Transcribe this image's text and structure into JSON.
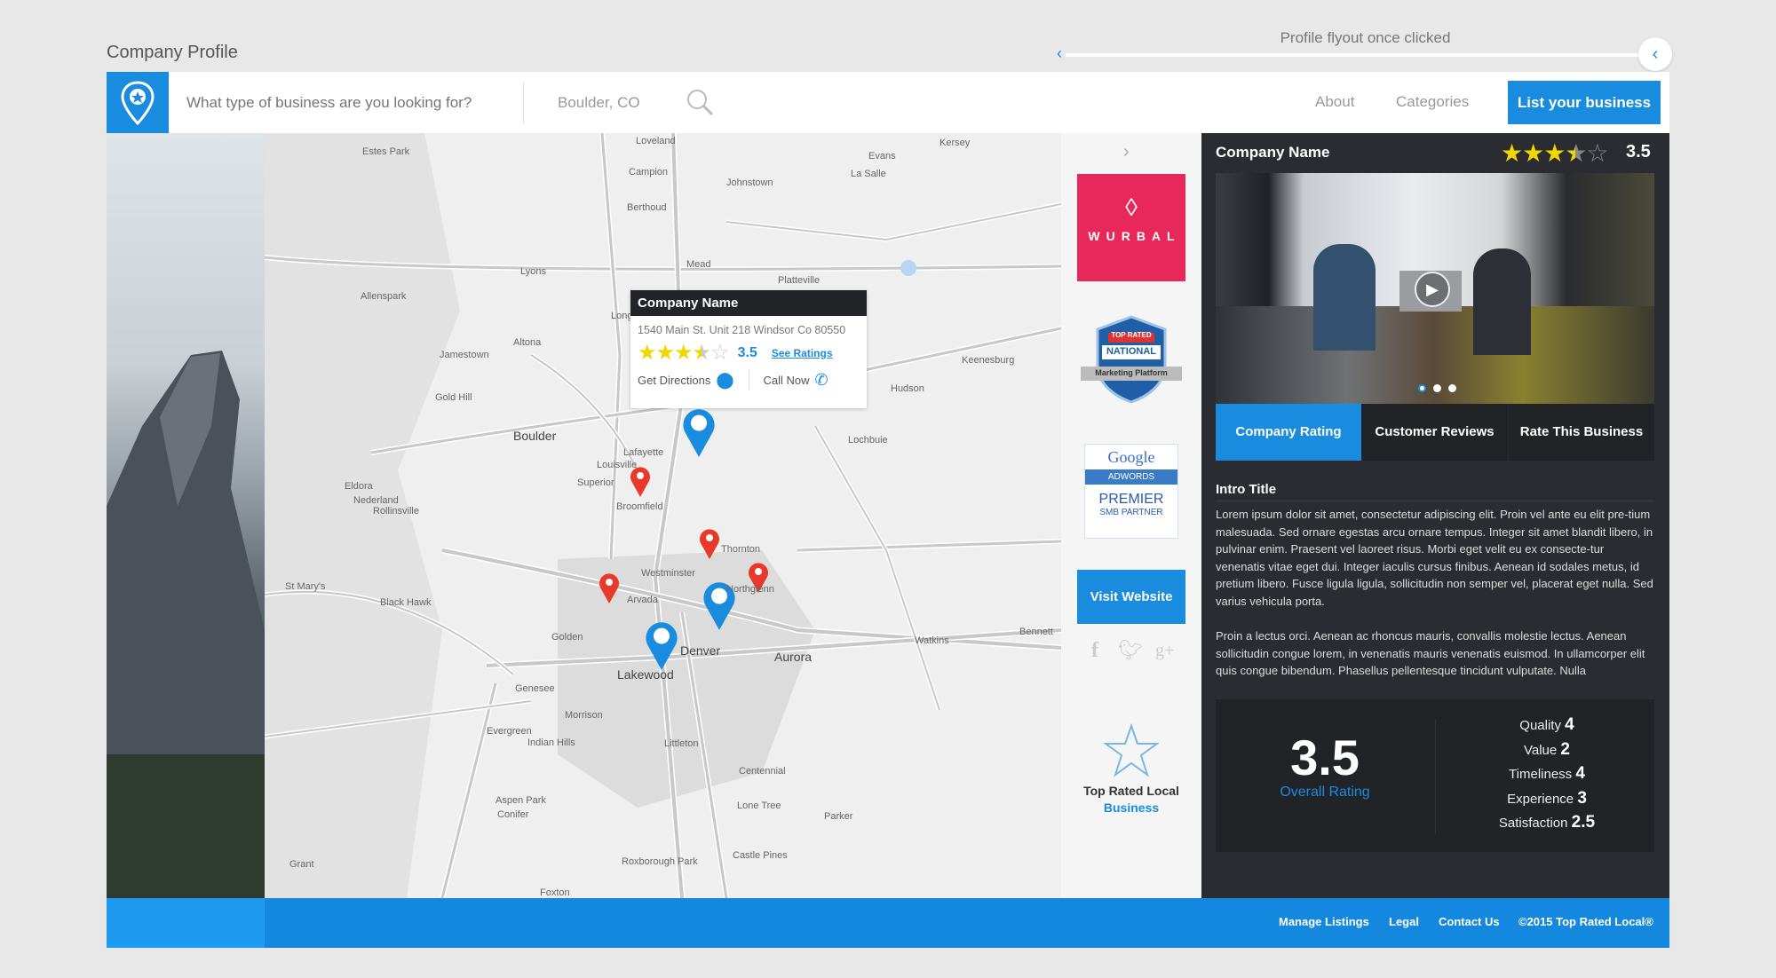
{
  "page": {
    "title": "Company Profile",
    "annotation": "Profile flyout once clicked"
  },
  "header": {
    "search_placeholder": "What type of business are you looking for?",
    "location_value": "Boulder, CO",
    "nav": [
      "About",
      "Categories"
    ],
    "cta": "List your business"
  },
  "map": {
    "cities": [
      "Loveland",
      "Estes Park",
      "Campion",
      "Berthoud",
      "Johnstown",
      "Evans",
      "La Salle",
      "Kersey",
      "Mead",
      "Platteville",
      "Lyons",
      "Allenspark",
      "Longmont",
      "Jamestown",
      "Altona",
      "Gold Hill",
      "Boulder",
      "Lafayette",
      "Louisville",
      "Superior",
      "Broomfield",
      "Eldora",
      "Nederland",
      "Rollinsville",
      "Thornton",
      "Westminster",
      "Arvada",
      "Northglenn",
      "Denver",
      "Aurora",
      "Lakewood",
      "Golden",
      "Black Hawk",
      "St Mary's",
      "Genesee",
      "Morrison",
      "Evergreen",
      "Indian Hills",
      "Littleton",
      "Centennial",
      "Aspen Park",
      "Conifer",
      "Lone Tree",
      "Parker",
      "Castle Pines",
      "Roxborough Park",
      "Grant",
      "Foxton",
      "Keenesburg",
      "Hudson",
      "Lochbuie",
      "Watkins",
      "Bennett"
    ],
    "popup": {
      "name": "Company Name",
      "address": "1540 Main St. Unit 218 Windsor Co 80550",
      "rating": "3.5",
      "see_ratings": "See Ratings",
      "directions": "Get Directions",
      "call": "Call Now"
    }
  },
  "side": {
    "sponsor1": "WURBAL",
    "badge_top": "TOP RATED",
    "badge_mid": "NATIONAL",
    "badge_bottom": "Marketing Platform",
    "google": "Google",
    "adwords": "ADWORDS",
    "premier": "PREMIER",
    "smb": "SMB PARTNER",
    "visit": "Visit Website",
    "trl_line1": "Top Rated Local",
    "trl_line2": "Business"
  },
  "panel": {
    "company_name": "Company Name",
    "rating": "3.5",
    "rating_value": 3.5,
    "tabs": [
      "Company Rating",
      "Customer Reviews",
      "Rate This Business"
    ],
    "active_tab": "Company Rating",
    "intro_title": "Intro Title",
    "para1": "Lorem ipsum dolor sit amet, consectetur adipiscing elit. Proin vel ante eu elit pre-tium malesuada. Sed ornare egestas arcu ornare tempus. Integer sit amet blandit libero, in pulvinar enim. Praesent vel laoreet risus. Morbi eget velit eu ex consecte-tur venenatis vitae eget dui. Integer iaculis cursus finibus. Aenean id sodales metus, id pretium libero. Fusce ligula ligula, sollicitudin non semper vel, placerat eget nulla. Sed varius vehicula porta.",
    "para2": "Proin a lectus orci. Aenean ac rhoncus mauris, convallis molestie lectus. Aenean sollicitudin congue lorem, in venenatis mauris venenatis euismod. In ullamcorper elit quis congue bibendum. Phasellus pellentesque tincidunt vulputate. Nulla",
    "overall": "3.5",
    "overall_label": "Overall Rating",
    "breakdown": [
      {
        "label": "Quality",
        "value": "4"
      },
      {
        "label": "Value",
        "value": "2"
      },
      {
        "label": "Timeliness",
        "value": "4"
      },
      {
        "label": "Experience",
        "value": "3"
      },
      {
        "label": "Satisfaction",
        "value": "2.5"
      }
    ],
    "carousel": {
      "slides": 3,
      "active": 1
    }
  },
  "footer": {
    "links": [
      "Manage Listings",
      "Legal",
      "Contact Us"
    ],
    "copyright": "©2015 Top Rated Local®"
  },
  "colors": {
    "accent": "#1a8ce0",
    "panel": "#2b2c31",
    "star": "#f2d600",
    "wurbal": "#e8285a",
    "marker_red": "#e8392b"
  }
}
